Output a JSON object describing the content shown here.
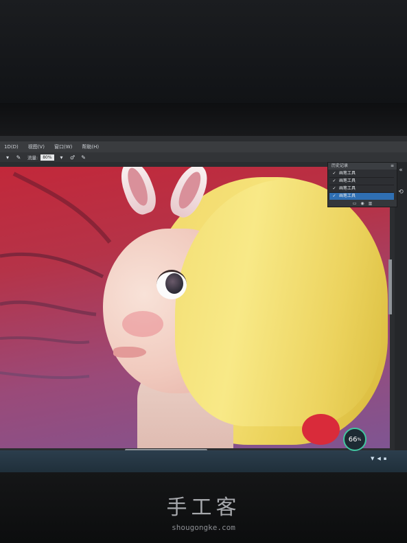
{
  "menubar": {
    "items": [
      "1D(D)",
      "视图(V)",
      "窗口(W)",
      "帮助(H)"
    ]
  },
  "options_bar": {
    "opacity_label": "流量:",
    "opacity_value": "80%"
  },
  "history_panel": {
    "title": "历史记录",
    "items": [
      {
        "label": "画笔工具",
        "selected": false
      },
      {
        "label": "画笔工具",
        "selected": false
      },
      {
        "label": "画笔工具",
        "selected": false
      },
      {
        "label": "画笔工具",
        "selected": true
      }
    ]
  },
  "taskbar": {
    "badge_value": "66",
    "badge_unit": "%"
  },
  "watermark": {
    "title": "手工客",
    "url": "shougongke.com"
  },
  "colors": {
    "selected_item": "#2f6fb3",
    "badge_ring": "#42c6a0"
  },
  "icons": [
    "brush-icon",
    "airbrush-icon",
    "checkmark-icon",
    "camera-icon",
    "trash-icon",
    "network-icon",
    "speaker-icon"
  ]
}
